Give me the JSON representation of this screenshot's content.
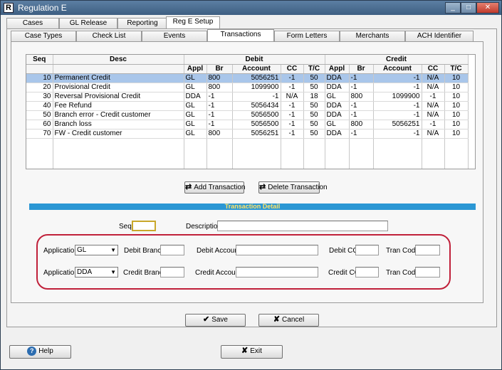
{
  "window": {
    "title": "Regulation E",
    "app_icon": "R",
    "minimize": "_",
    "maximize": "□",
    "close": "✕"
  },
  "main_tabs": [
    {
      "label": "Cases"
    },
    {
      "label": "GL Release"
    },
    {
      "label": "Reporting"
    },
    {
      "label": "Reg E Setup"
    }
  ],
  "sub_tabs": [
    {
      "label": "Case Types"
    },
    {
      "label": "Check List"
    },
    {
      "label": "Events"
    },
    {
      "label": "Transactions"
    },
    {
      "label": "Form Letters"
    },
    {
      "label": "Merchants"
    },
    {
      "label": "ACH Identifier"
    }
  ],
  "grid": {
    "group_headers": {
      "seq": "Seq",
      "desc": "Desc",
      "debit": "Debit",
      "credit": "Credit"
    },
    "columns": [
      "Appl",
      "Br",
      "Account",
      "CC",
      "T/C",
      "Appl",
      "Br",
      "Account",
      "CC",
      "T/C"
    ],
    "rows": [
      [
        "10",
        "Permanent Credit",
        "GL",
        "800",
        "5056251",
        "-1",
        "50",
        "DDA",
        "-1",
        "-1",
        "N/A",
        "10"
      ],
      [
        "20",
        "Provisional Credit",
        "GL",
        "800",
        "1099900",
        "-1",
        "50",
        "DDA",
        "-1",
        "-1",
        "N/A",
        "10"
      ],
      [
        "30",
        "Reversal Provisional Credit",
        "DDA",
        "-1",
        "-1",
        "N/A",
        "18",
        "GL",
        "800",
        "1099900",
        "-1",
        "10"
      ],
      [
        "40",
        "Fee Refund",
        "GL",
        "-1",
        "5056434",
        "-1",
        "50",
        "DDA",
        "-1",
        "-1",
        "N/A",
        "10"
      ],
      [
        "50",
        "Branch error - Credit customer",
        "GL",
        "-1",
        "5056500",
        "-1",
        "50",
        "DDA",
        "-1",
        "-1",
        "N/A",
        "10"
      ],
      [
        "60",
        "Branch loss",
        "GL",
        "-1",
        "5056500",
        "-1",
        "50",
        "GL",
        "800",
        "5056251",
        "-1",
        "10"
      ],
      [
        "70",
        "FW - Credit customer",
        "GL",
        "800",
        "5056251",
        "-1",
        "50",
        "DDA",
        "-1",
        "-1",
        "N/A",
        "10"
      ]
    ]
  },
  "buttons": {
    "add_transaction": "Add Transaction",
    "delete_transaction": "Delete Transaction",
    "save": "Save",
    "cancel": "Cancel",
    "help": "Help",
    "exit": "Exit"
  },
  "icons": {
    "add": "⇄",
    "delete": "⇄",
    "save": "✔",
    "cancel": "✘",
    "help": "?",
    "exit": "✘"
  },
  "detail": {
    "header": "Transaction Detail",
    "seq_label": "Seq",
    "seq_value": "",
    "description_label": "Description",
    "description_value": "",
    "debit": {
      "application_label": "Application",
      "application_value": "GL",
      "branch_label": "Debit Branch",
      "account_label": "Debit Account",
      "cc_label": "Debit CC",
      "tran_code_label": "Tran Code"
    },
    "credit": {
      "application_label": "Application",
      "application_value": "DDA",
      "branch_label": "Credit Branch",
      "account_label": "Credit Account",
      "cc_label": "Credit CC",
      "tran_code_label": "Tran Code"
    }
  },
  "colors": {
    "selected_row": "#a9c6ea",
    "detail_header_bg": "#2b97d4",
    "detail_header_text": "#ffe36a",
    "highlight_oval": "#c0203a"
  }
}
